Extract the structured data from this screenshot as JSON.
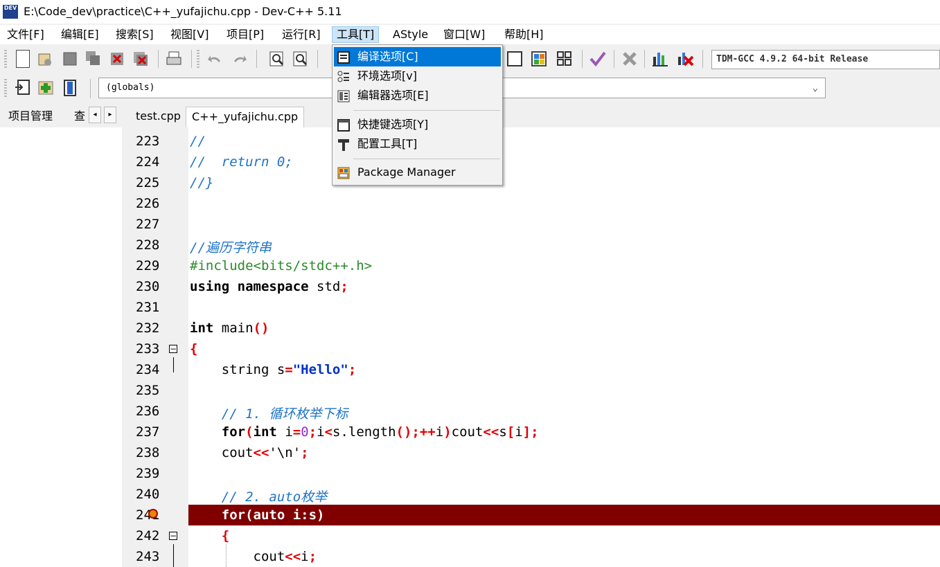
{
  "window": {
    "app_icon_text": "DEV",
    "title": "E:\\Code_dev\\practice\\C++_yufajichu.cpp - Dev-C++ 5.11"
  },
  "menubar": {
    "items": [
      "文件[F]",
      "编辑[E]",
      "搜索[S]",
      "视图[V]",
      "项目[P]",
      "运行[R]",
      "工具[T]",
      "AStyle",
      "窗口[W]",
      "帮助[H]"
    ],
    "active_index": 6
  },
  "toolbar": {
    "compiler_select": "TDM-GCC 4.9.2 64-bit Release",
    "scope_select": "(globals)"
  },
  "tools_menu": {
    "items": [
      {
        "label": "编译选项[C]",
        "icon": "compiler-options-icon",
        "selected": true
      },
      {
        "label": "环境选项[v]",
        "icon": "environment-options-icon"
      },
      {
        "label": "编辑器选项[E]",
        "icon": "editor-options-icon"
      },
      {
        "label": "快捷键选项[Y]",
        "icon": "shortcut-options-icon"
      },
      {
        "label": "配置工具[T]",
        "icon": "hammer-icon"
      },
      {
        "label": "Package Manager",
        "icon": "package-manager-icon"
      }
    ]
  },
  "left_panel": {
    "tab_label": "项目管理",
    "tab2_partial": "查",
    "prev_arrow": "◂",
    "next_arrow": "▸"
  },
  "file_tabs": [
    {
      "label": "test.cpp",
      "active": false
    },
    {
      "label": "C++_yufajichu.cpp",
      "active": true
    }
  ],
  "editor": {
    "line_numbers": [
      "223",
      "224",
      "225",
      "226",
      "227",
      "228",
      "229",
      "230",
      "231",
      "232",
      "233",
      "234",
      "235",
      "236",
      "237",
      "238",
      "239",
      "240",
      "241",
      "242",
      "243"
    ],
    "breakpoint_line": "241",
    "highlighted_line": "241",
    "fold_markers": [
      "233",
      "242"
    ],
    "code": {
      "l223": "//",
      "l224": "//  return 0;",
      "l225": "//}",
      "l228": "//遍历字符串",
      "l229": "#include<bits/stdc++.h>",
      "l230_kw": "using namespace",
      "l230_id": " std",
      "l230_sy": ";",
      "l232_kw": "int",
      "l232_id": " main",
      "l232_sy": "()",
      "l233": "{",
      "l234_id": "    string s",
      "l234_sy1": "=",
      "l234_str": "\"Hello\"",
      "l234_sy2": ";",
      "l236": "    // 1. 循环枚举下标",
      "l237_pre": "    ",
      "l237_kw1": "for",
      "l237_sy1": "(",
      "l237_kw2": "int",
      "l237_id1": " i",
      "l237_sy2": "=",
      "l237_num": "0",
      "l237_sy3": ";",
      "l237_id2": "i",
      "l237_sy4": "<",
      "l237_id3": "s.length",
      "l237_sy5": "();++",
      "l237_id4": "i",
      "l237_sy6": ")",
      "l237_id5": "cout",
      "l237_sy7": "<<",
      "l237_id6": "s",
      "l237_sy8": "[",
      "l237_id7": "i",
      "l237_sy9": "];",
      "l238_id": "    cout",
      "l238_sy1": "<<",
      "l238_ch": "'\\n'",
      "l238_sy2": ";",
      "l240": "    // 2. auto枚举",
      "l241": "    for(auto i:s)",
      "l242": "    {",
      "l243_id": "        cout",
      "l243_sy1": "<<",
      "l243_id2": "i",
      "l243_sy2": ";"
    }
  },
  "colors": {
    "highlight_line": "#800000",
    "menu_selected": "#0078d7",
    "comment": "#1e73c7",
    "preprocessor": "#2a8a2a",
    "symbol": "#e00000",
    "string": "#0030c8"
  }
}
